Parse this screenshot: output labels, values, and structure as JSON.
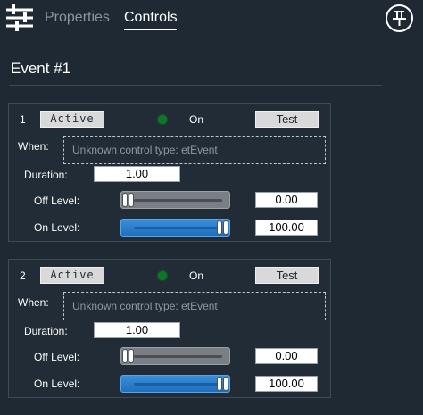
{
  "header": {
    "tabs": [
      {
        "label": "Properties",
        "selected": false
      },
      {
        "label": "Controls",
        "selected": true
      }
    ]
  },
  "page": {
    "title": "Event #1"
  },
  "events": [
    {
      "number": "1",
      "active_label": "Active",
      "status_label": "On",
      "test_label": "Test",
      "when_label": "When:",
      "when_placeholder": "Unknown control type: etEvent",
      "duration_label": "Duration:",
      "duration_value": "1.00",
      "off_level_label": "Off Level:",
      "off_level_value": "0.00",
      "on_level_label": "On Level:",
      "on_level_value": "100.00",
      "off_level_fraction": 0,
      "on_level_fraction": 1
    },
    {
      "number": "2",
      "active_label": "Active",
      "status_label": "On",
      "test_label": "Test",
      "when_label": "When:",
      "when_placeholder": "Unknown control type: etEvent",
      "duration_label": "Duration:",
      "duration_value": "1.00",
      "off_level_label": "Off Level:",
      "off_level_value": "0.00",
      "on_level_label": "On Level:",
      "on_level_value": "100.00",
      "off_level_fraction": 0,
      "on_level_fraction": 1
    }
  ],
  "icons": {
    "filter": "sliders-filter-icon",
    "pin": "pushpin-icon",
    "status": "status-led-icon"
  },
  "colors": {
    "background": "#1f2933",
    "led_on": "#0b7a22",
    "slider_active": "#2a7fcc"
  }
}
